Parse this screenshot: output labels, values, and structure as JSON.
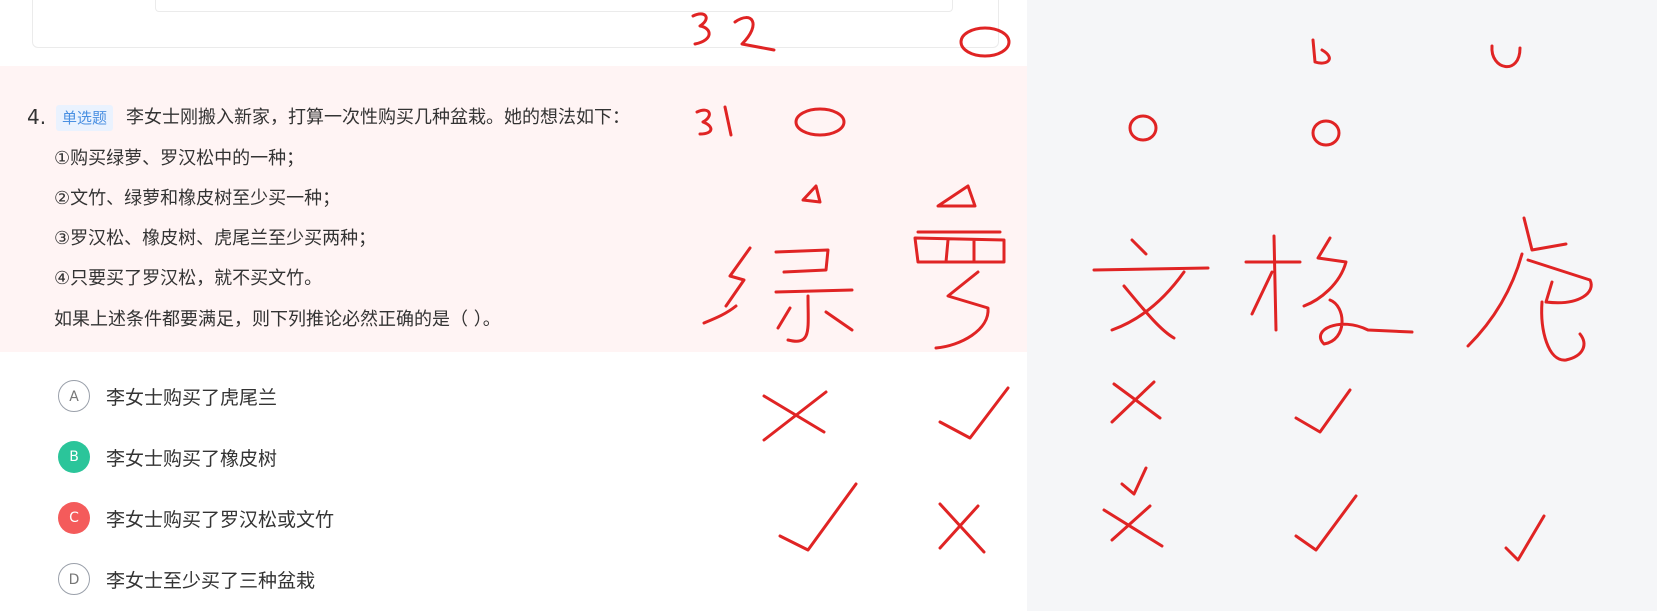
{
  "question": {
    "number": "4.",
    "type_tag": "单选题",
    "stem": "李女士刚搬入新家，打算一次性购买几种盆栽。她的想法如下：",
    "conditions": [
      "①购买绿萝、罗汉松中的一种；",
      "②文竹、绿萝和橡皮树至少买一种；",
      "③罗汉松、橡皮树、虎尾兰至少买两种；",
      "④只要买了罗汉松，就不买文竹。"
    ],
    "ask": "如果上述条件都要满足，则下列推论必然正确的是（ ）。"
  },
  "options": [
    {
      "letter": "A",
      "text": "李女士购买了虎尾兰",
      "state": "plain"
    },
    {
      "letter": "B",
      "text": "李女士购买了橡皮树",
      "state": "correct"
    },
    {
      "letter": "C",
      "text": "李女士购买了罗汉松或文竹",
      "state": "wrong"
    },
    {
      "letter": "D",
      "text": "李女士至少买了三种盆栽",
      "state": "plain"
    }
  ],
  "colors": {
    "highlight_bg": "#fff4f4",
    "tag_text": "#4a90e2",
    "correct": "#2bc59a",
    "wrong": "#f45b5b",
    "ink": "#e02424"
  }
}
